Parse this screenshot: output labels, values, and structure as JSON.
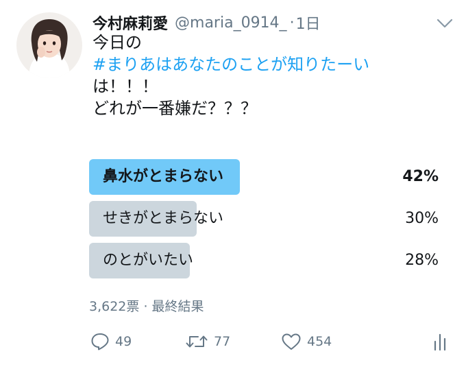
{
  "tweet": {
    "display_name": "今村麻莉愛",
    "handle": "@maria_0914_",
    "separator": "·",
    "time": "1日",
    "text_line1": "今日の",
    "hashtag": "#まりあはあなたのことが知りたーい",
    "text_line3": "は！！！",
    "text_line4": "どれが一番嫌だ？？？"
  },
  "poll": {
    "options": [
      {
        "label": "鼻水がとまらない",
        "percent_text": "42%",
        "percent": 42,
        "winner": true
      },
      {
        "label": "せきがとまらない",
        "percent_text": "30%",
        "percent": 30,
        "winner": false
      },
      {
        "label": "のとがいたい",
        "percent_text": "28%",
        "percent": 28,
        "winner": false
      }
    ],
    "votes": "3,622票",
    "meta_separator": "·",
    "status": "最終結果"
  },
  "actions": {
    "reply_count": "49",
    "retweet_count": "77",
    "like_count": "454"
  },
  "colors": {
    "accent": "#1da1f2",
    "winner_bar": "#71c9f8",
    "bar": "#ccd6dd",
    "muted_text": "#657786"
  },
  "icons": [
    "reply-icon",
    "retweet-icon",
    "like-icon",
    "analytics-icon",
    "chevron-down-icon"
  ]
}
